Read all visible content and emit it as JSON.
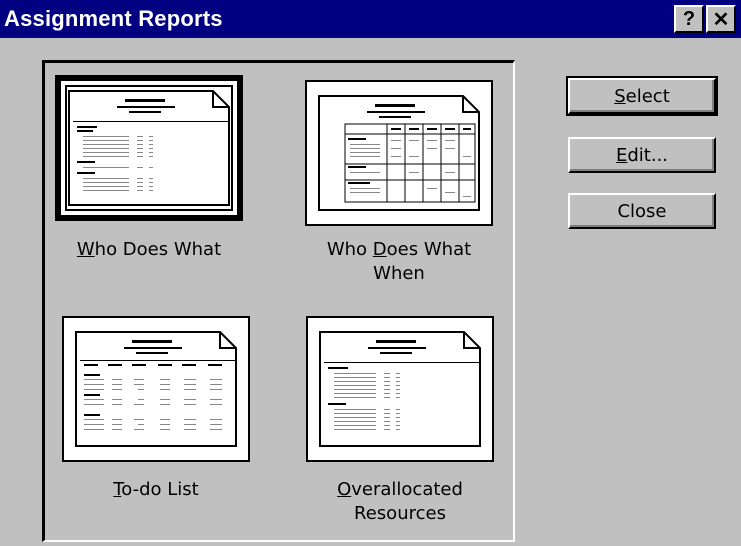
{
  "window": {
    "title": "Assignment Reports",
    "help_button": "?",
    "close_button": "✕"
  },
  "reports": [
    {
      "accel": "W",
      "rest": "ho Does What",
      "line2": "",
      "selected": true,
      "icon": "simple-report-icon"
    },
    {
      "pre": "Who ",
      "accel": "D",
      "rest": "oes What",
      "line2": "When",
      "selected": false,
      "icon": "grid-report-icon"
    },
    {
      "accel": "T",
      "rest": "o-do List",
      "line2": "",
      "selected": false,
      "icon": "list-report-icon"
    },
    {
      "accel": "O",
      "rest": "verallocated",
      "line2": "Resources",
      "selected": false,
      "icon": "overallocated-report-icon"
    }
  ],
  "buttons": {
    "select": {
      "accel": "S",
      "rest": "elect"
    },
    "edit": {
      "accel": "E",
      "rest": "dit..."
    },
    "close": {
      "label": "Close"
    }
  }
}
